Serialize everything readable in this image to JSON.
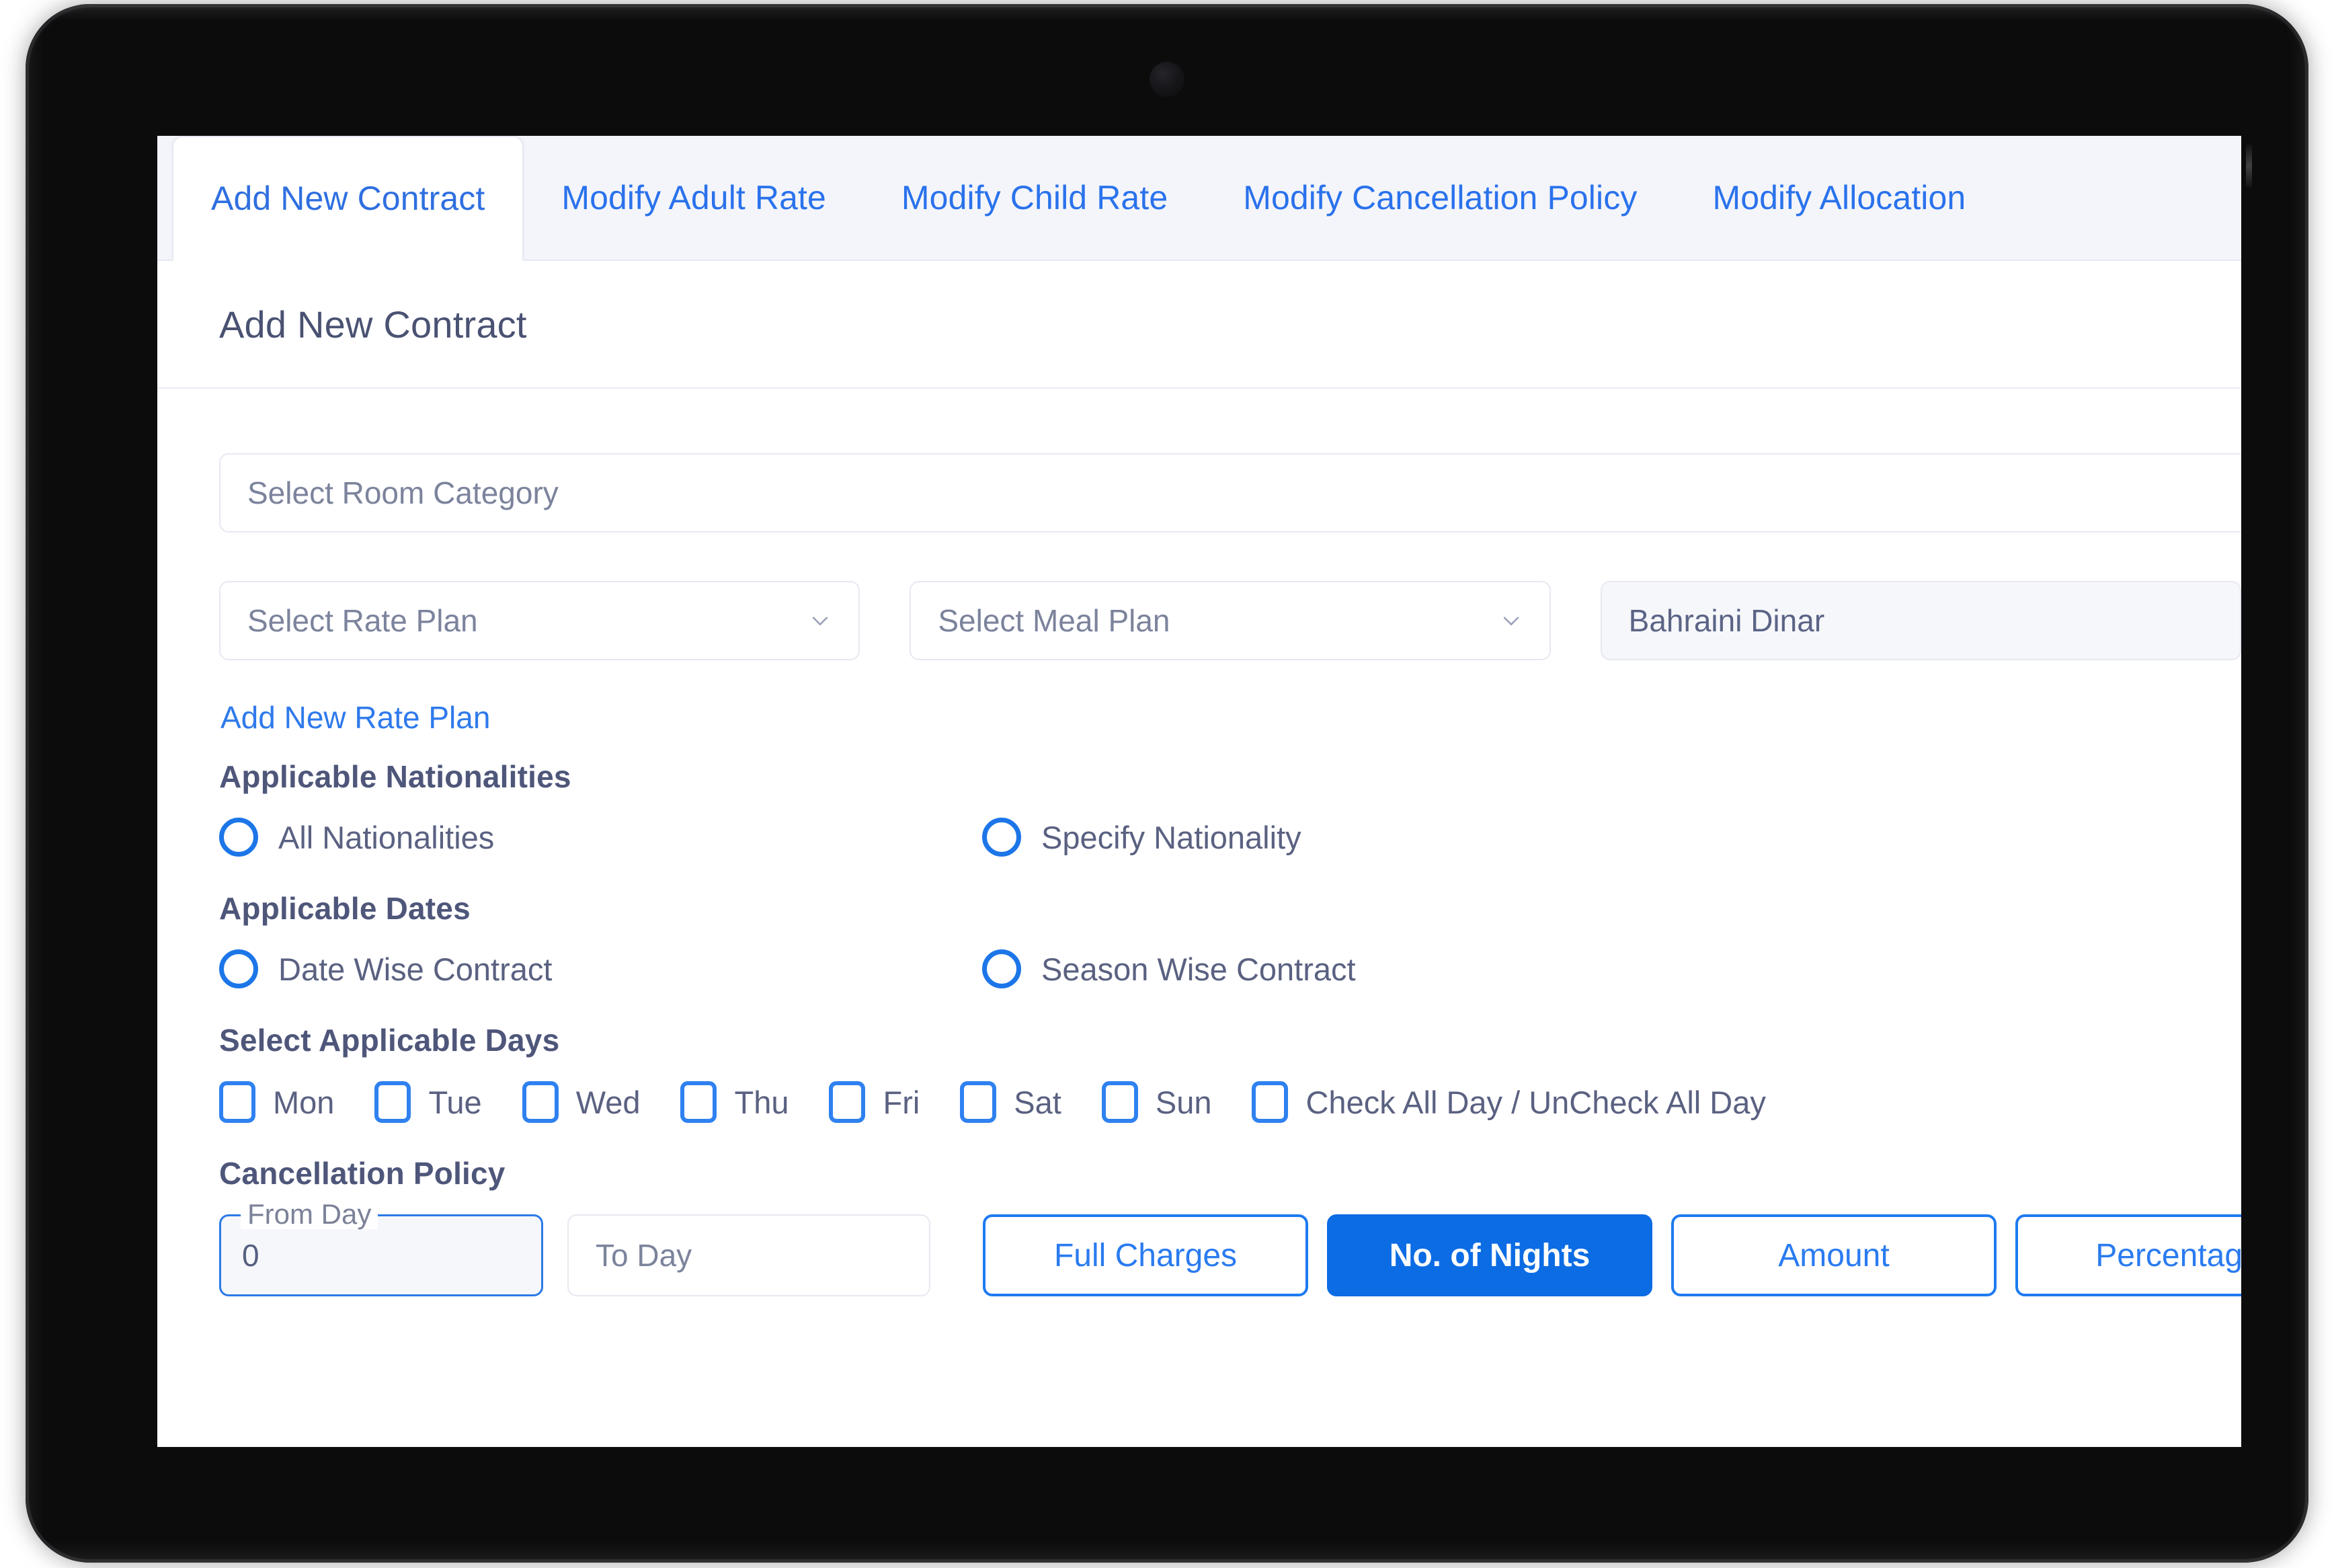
{
  "device": {
    "camera_icon": "front-camera",
    "side_button_icon": "side-button"
  },
  "tabs": [
    {
      "label": "Add New Contract",
      "active": true
    },
    {
      "label": "Modify Adult Rate",
      "active": false
    },
    {
      "label": "Modify Child Rate",
      "active": false
    },
    {
      "label": "Modify Cancellation Policy",
      "active": false
    },
    {
      "label": "Modify Allocation",
      "active": false
    }
  ],
  "page": {
    "title": "Add New Contract"
  },
  "form": {
    "room_category_placeholder": "Select Room Category",
    "rate_plan_placeholder": "Select Rate Plan",
    "meal_plan_placeholder": "Select Meal Plan",
    "currency_value": "Bahraini Dinar",
    "add_rate_plan_link": "Add New Rate Plan",
    "nationalities_label": "Applicable Nationalities",
    "nationality_options": [
      {
        "label": "All Nationalities",
        "selected": false
      },
      {
        "label": "Specify Nationality",
        "selected": false
      }
    ],
    "dates_label": "Applicable Dates",
    "date_options": [
      {
        "label": "Date Wise Contract",
        "selected": false
      },
      {
        "label": "Season Wise Contract",
        "selected": false
      }
    ],
    "days_label": "Select Applicable Days",
    "days": [
      {
        "label": "Mon",
        "checked": false
      },
      {
        "label": "Tue",
        "checked": false
      },
      {
        "label": "Wed",
        "checked": false
      },
      {
        "label": "Thu",
        "checked": false
      },
      {
        "label": "Fri",
        "checked": false
      },
      {
        "label": "Sat",
        "checked": false
      },
      {
        "label": "Sun",
        "checked": false
      },
      {
        "label": "Check All Day / UnCheck All Day",
        "checked": false
      }
    ],
    "cancellation_label": "Cancellation Policy",
    "from_day_label": "From Day",
    "from_day_value": "0",
    "to_day_placeholder": "To Day",
    "charge_buttons": [
      {
        "label": "Full Charges",
        "active": false
      },
      {
        "label": "No. of Nights",
        "active": true
      },
      {
        "label": "Amount",
        "active": false
      },
      {
        "label": "Percentage",
        "active": false
      }
    ]
  },
  "colors": {
    "accent_blue": "#0c6ce4",
    "link_blue": "#2f7aeb",
    "tab_blue": "#2a72ec",
    "heading_slate": "#4a5273",
    "label_slate": "#4e567a",
    "placeholder_gray": "#7c839c",
    "tabbar_bg": "#f4f5fa",
    "field_border": "#e7e9f1",
    "filled_field_bg": "#f6f7fa"
  }
}
